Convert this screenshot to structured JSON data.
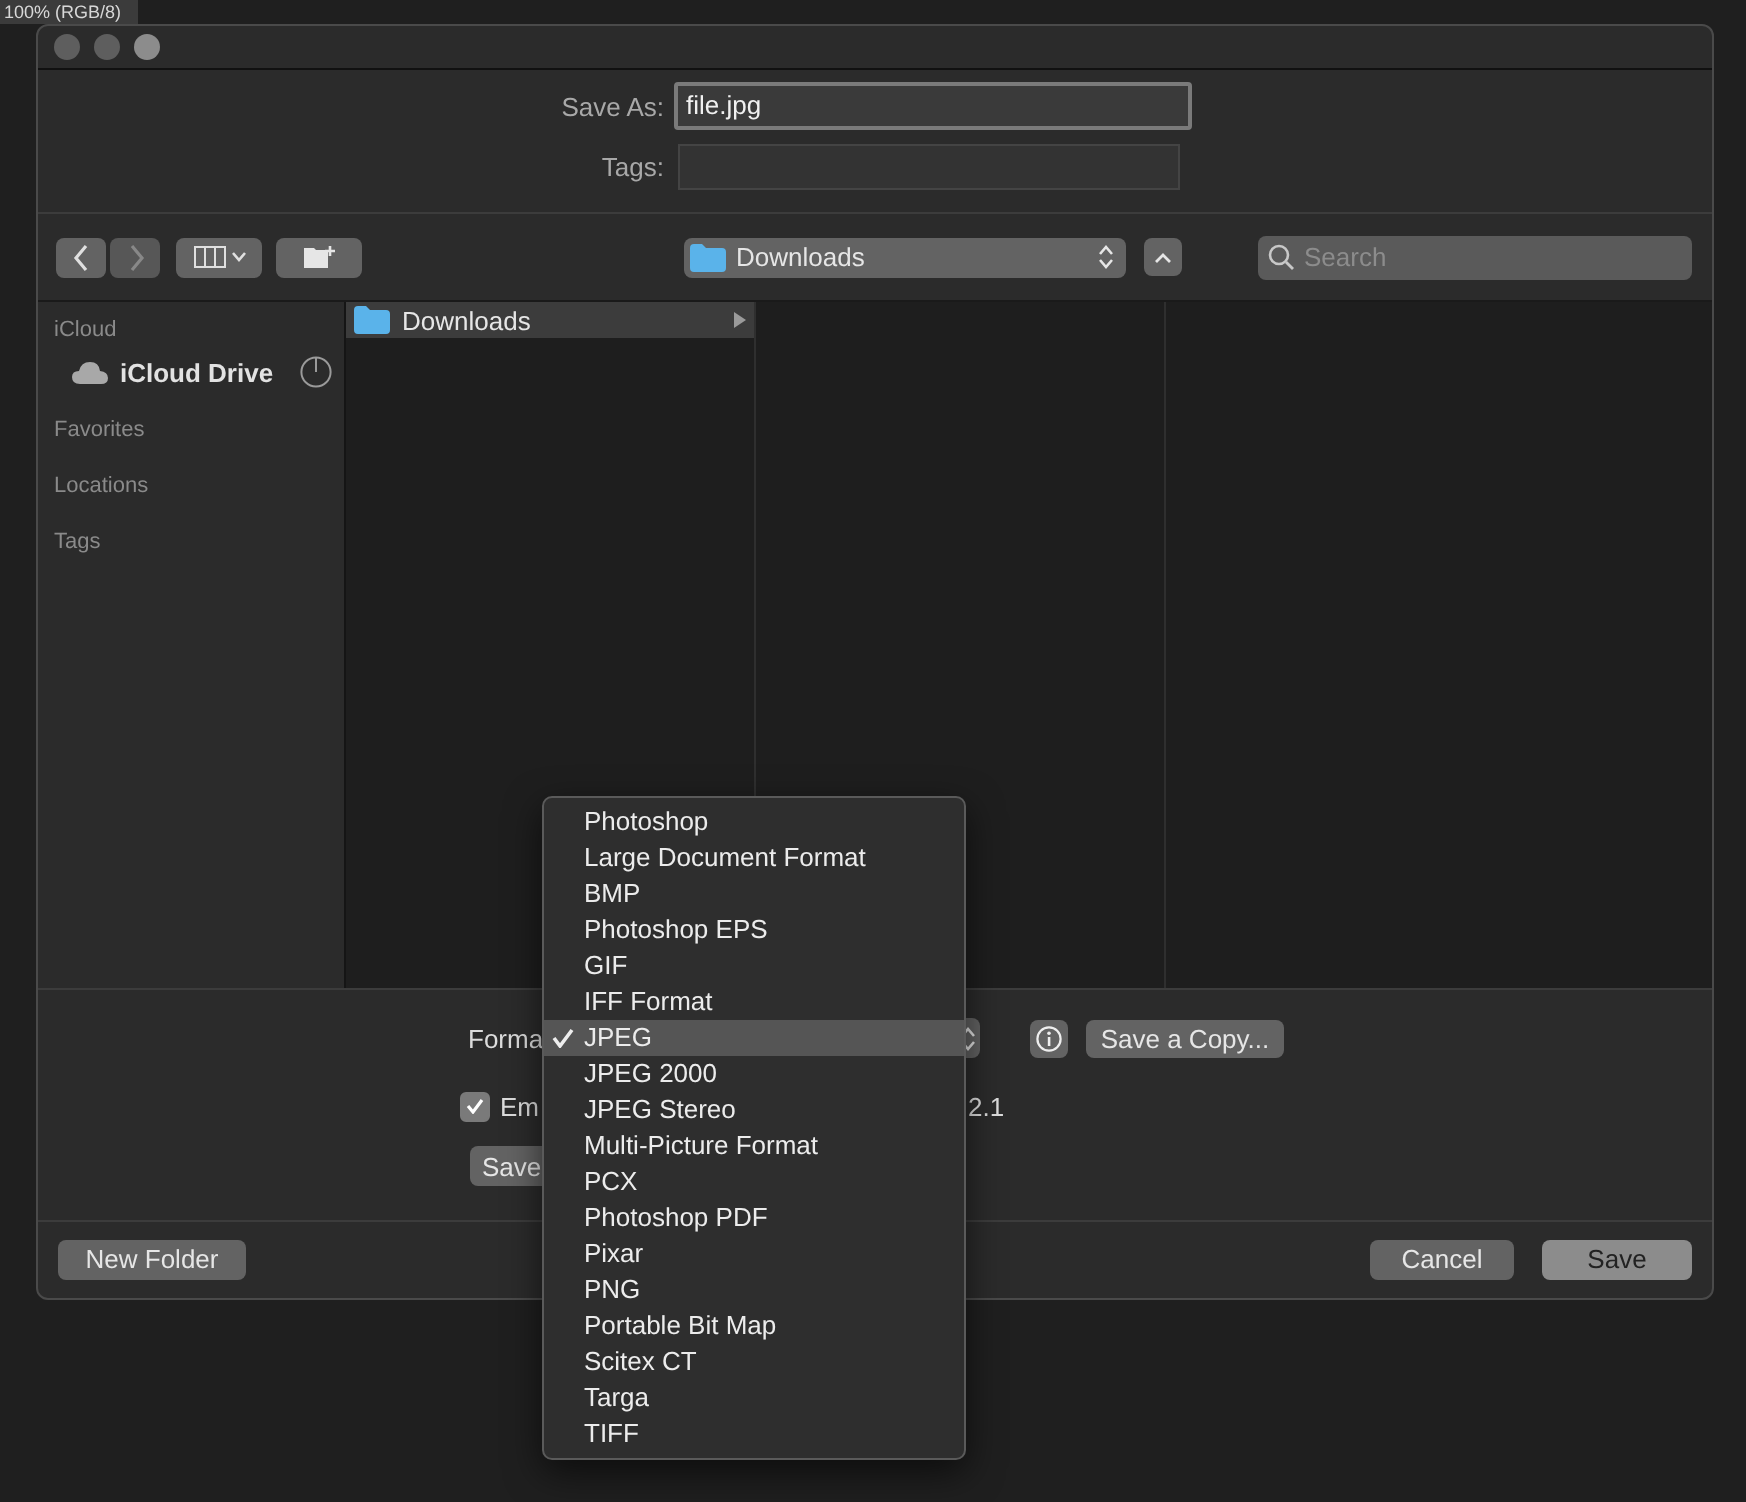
{
  "background_tab": {
    "title": "100% (RGB/8)"
  },
  "save_as": {
    "label": "Save As:",
    "value": "file.jpg"
  },
  "tags": {
    "label": "Tags:"
  },
  "toolbar": {
    "location": "Downloads",
    "search_placeholder": "Search"
  },
  "sidebar": {
    "sections": [
      {
        "title": "iCloud",
        "items": [
          {
            "label": "iCloud Drive",
            "selected": false
          }
        ]
      },
      {
        "title": "Favorites"
      },
      {
        "title": "Locations"
      },
      {
        "title": "Tags"
      }
    ]
  },
  "browser": {
    "items": [
      {
        "label": "Downloads",
        "selected": true
      }
    ]
  },
  "options": {
    "format_label": "Forma",
    "embed": {
      "label": "Em",
      "checked": true,
      "suffix": "2.1"
    },
    "save_button": "Save",
    "save_copy_button": "Save a Copy..."
  },
  "format_menu": {
    "items": [
      {
        "label": "Photoshop",
        "selected": false
      },
      {
        "label": "Large Document Format",
        "selected": false
      },
      {
        "label": "BMP",
        "selected": false
      },
      {
        "label": "Photoshop EPS",
        "selected": false
      },
      {
        "label": "GIF",
        "selected": false
      },
      {
        "label": "IFF Format",
        "selected": false
      },
      {
        "label": "JPEG",
        "selected": true
      },
      {
        "label": "JPEG 2000",
        "selected": false
      },
      {
        "label": "JPEG Stereo",
        "selected": false
      },
      {
        "label": "Multi-Picture Format",
        "selected": false
      },
      {
        "label": "PCX",
        "selected": false
      },
      {
        "label": "Photoshop PDF",
        "selected": false
      },
      {
        "label": "Pixar",
        "selected": false
      },
      {
        "label": "PNG",
        "selected": false
      },
      {
        "label": "Portable Bit Map",
        "selected": false
      },
      {
        "label": "Scitex CT",
        "selected": false
      },
      {
        "label": "Targa",
        "selected": false
      },
      {
        "label": "TIFF",
        "selected": false
      }
    ]
  },
  "buttons": {
    "new_folder": "New Folder",
    "cancel": "Cancel",
    "save": "Save"
  }
}
